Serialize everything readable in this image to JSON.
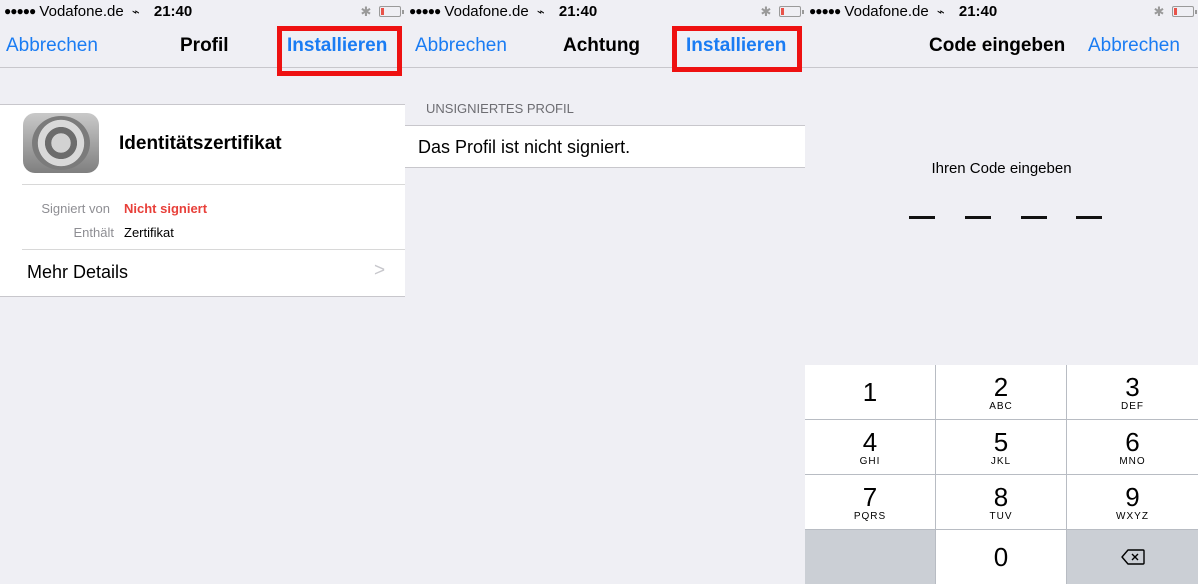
{
  "status": {
    "carrier": "Vodafone.de",
    "time": "21:40"
  },
  "screen1": {
    "nav": {
      "left": "Abbrechen",
      "title": "Profil",
      "right": "Installieren"
    },
    "profile_icon": "settings-gear-icon",
    "certificate_name": "Identitätszertifikat",
    "details": [
      {
        "label": "Signiert von",
        "value": "Nicht signiert"
      },
      {
        "label": "Enthält",
        "value": "Zertifikat"
      }
    ],
    "more_details": "Mehr Details",
    "chevron": ">"
  },
  "screen2": {
    "nav": {
      "left": "Abbrechen",
      "title": "Achtung",
      "right": "Installieren"
    },
    "section_header": "UNSIGNIERTES PROFIL",
    "message": "Das Profil ist nicht signiert."
  },
  "screen3": {
    "nav": {
      "title": "Code eingeben",
      "right": "Abbrechen"
    },
    "prompt": "Ihren Code eingeben",
    "keypad": [
      {
        "num": "1",
        "letters": ""
      },
      {
        "num": "2",
        "letters": "ABC"
      },
      {
        "num": "3",
        "letters": "DEF"
      },
      {
        "num": "4",
        "letters": "GHI"
      },
      {
        "num": "5",
        "letters": "JKL"
      },
      {
        "num": "6",
        "letters": "MNO"
      },
      {
        "num": "7",
        "letters": "PQRS"
      },
      {
        "num": "8",
        "letters": "TUV"
      },
      {
        "num": "9",
        "letters": "WXYZ"
      },
      {
        "num": "0",
        "letters": ""
      }
    ],
    "delete_icon": "backspace-icon"
  },
  "colors": {
    "ios_blue": "#1a7cf3",
    "highlight_red": "#ee1111",
    "warning_red": "#e8403a",
    "background": "#efeff4"
  }
}
